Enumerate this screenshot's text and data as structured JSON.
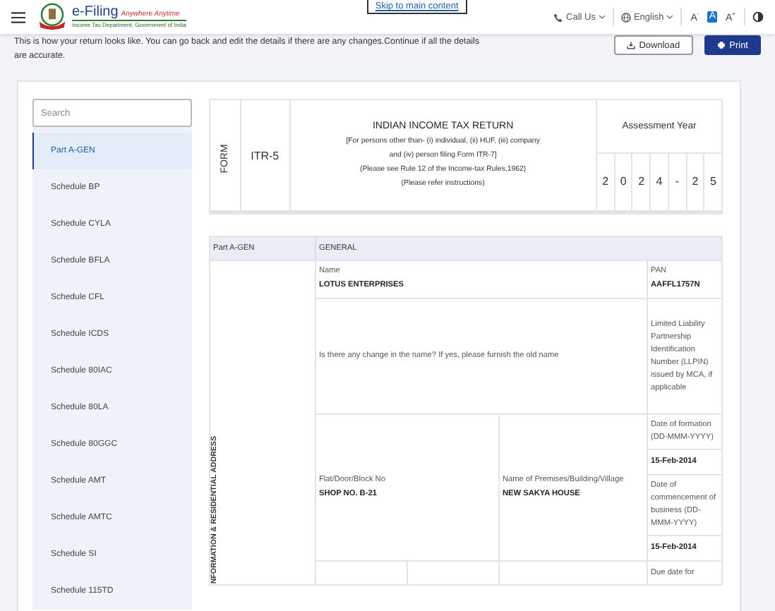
{
  "header": {
    "logo_title": "e-Filing",
    "logo_tagline": "Anywhere Anytime",
    "logo_subtitle": "Income Tax Department, Government of India",
    "skip_link": "Skip to main content",
    "call_us": "Call Us",
    "language": "English",
    "font_sizes": [
      {
        "label": "A",
        "sign": "-",
        "selected": false
      },
      {
        "label": "A",
        "selected": true
      },
      {
        "label": "A",
        "sign": "+",
        "selected": false
      }
    ]
  },
  "intro": "This is how your return looks like. You can go back and edit the details if there are any changes.Continue if all the details are accurate.",
  "actions": [
    {
      "label": "Download",
      "kind": "outline"
    },
    {
      "label": "Print",
      "kind": "primary"
    }
  ],
  "sidebar": {
    "search_placeholder": "Search",
    "items": [
      {
        "label": "Part A-GEN",
        "selected": true
      },
      {
        "label": "Schedule BP",
        "selected": false
      },
      {
        "label": "Schedule CYLA",
        "selected": false
      },
      {
        "label": "Schedule BFLA",
        "selected": false
      },
      {
        "label": "Schedule CFL",
        "selected": false
      },
      {
        "label": "Schedule ICDS",
        "selected": false
      },
      {
        "label": "Schedule 80IAC",
        "selected": false
      },
      {
        "label": "Schedule 80LA",
        "selected": false
      },
      {
        "label": "Schedule 80GGC",
        "selected": false
      },
      {
        "label": "Schedule AMT",
        "selected": false
      },
      {
        "label": "Schedule AMTC",
        "selected": false
      },
      {
        "label": "Schedule SI",
        "selected": false
      },
      {
        "label": "Schedule 115TD",
        "selected": false
      }
    ]
  },
  "form_header": {
    "form_label": "FORM",
    "form_name": "ITR-5",
    "title": "INDIAN INCOME TAX RETURN",
    "lines": [
      "[For persons other than- (i) individual, (ii) HUF, (iii) company",
      "and (iv) person filing Form ITR-7]",
      "(Please see Rule 12 of the Income-tax Rules,1962)",
      "(Please refer instructions)"
    ],
    "ay_label": "Assessment Year",
    "ay_chars": [
      "2",
      "0",
      "2",
      "4",
      "-",
      "2",
      "5"
    ]
  },
  "section": {
    "part": "Part A-GEN",
    "title": "GENERAL",
    "side_label": "NFORMATION & RESIDENTIAL ADDRESS",
    "name_label": "Name",
    "name_value": "LOTUS ENTERPRISES",
    "pan_label": "PAN",
    "pan_value": "AAFFL1757N",
    "change_label": "Is there any change in the name? If yes, please furnish the old name",
    "llpin_label": "Limited Liability Partnership Identification Number (LLPIN) issued by MCA, if applicable",
    "flat_label": "Flat/Door/Block No",
    "flat_value": "SHOP NO. B-21",
    "premises_label": "Name of Premises/Building/Village",
    "premises_value": "NEW SAKYA HOUSE",
    "dates": [
      {
        "label": "Date of formation (DD-MMM-YYYY)",
        "value": "15-Feb-2014"
      },
      {
        "label": "Date of commencement of business (DD-MMM-YYYY)",
        "value": "15-Feb-2014"
      }
    ],
    "next_label": "Due date for"
  }
}
